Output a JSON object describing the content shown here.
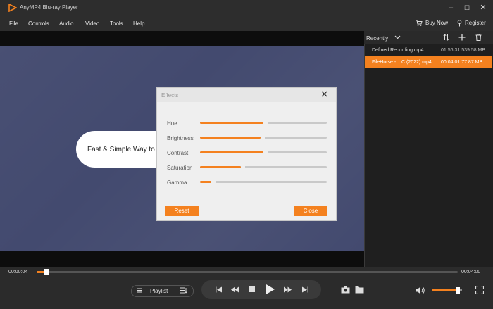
{
  "window": {
    "title": "AnyMP4 Blu-ray Player",
    "controls": {
      "minimize": "–",
      "maximize": "☐",
      "close": "✕"
    }
  },
  "menu": {
    "items": [
      "File",
      "Controls",
      "Audio",
      "Video",
      "Tools",
      "Help"
    ],
    "buy_now": "Buy Now",
    "register": "Register"
  },
  "video": {
    "overlay_text": "Fast & Simple Way to D"
  },
  "playlist": {
    "sort_label": "Recently",
    "rows": [
      {
        "name": "Defined Recording.mp4",
        "duration": "01:56:31",
        "size": "539.58 MB",
        "selected": false
      },
      {
        "name": "FileHorse - ...C (2022).mp4",
        "duration": "00:04:01",
        "size": "77.87 MB",
        "selected": true
      }
    ]
  },
  "effects_dialog": {
    "title": "Effects",
    "sliders": [
      {
        "label": "Hue",
        "value": 0.5
      },
      {
        "label": "Brightness",
        "value": 0.48
      },
      {
        "label": "Contrast",
        "value": 0.5
      },
      {
        "label": "Saturation",
        "value": 0.32
      },
      {
        "label": "Gamma",
        "value": 0.09
      }
    ],
    "reset_label": "Reset",
    "close_label": "Close"
  },
  "player": {
    "current_time": "00:00:04",
    "total_time": "00:04:00",
    "progress": 0.017,
    "playlist_label": "Playlist",
    "volume": 0.85
  },
  "colors": {
    "accent": "#f4811f",
    "video_bg": "#434a6f",
    "panel_bg": "#1f1f1f"
  }
}
